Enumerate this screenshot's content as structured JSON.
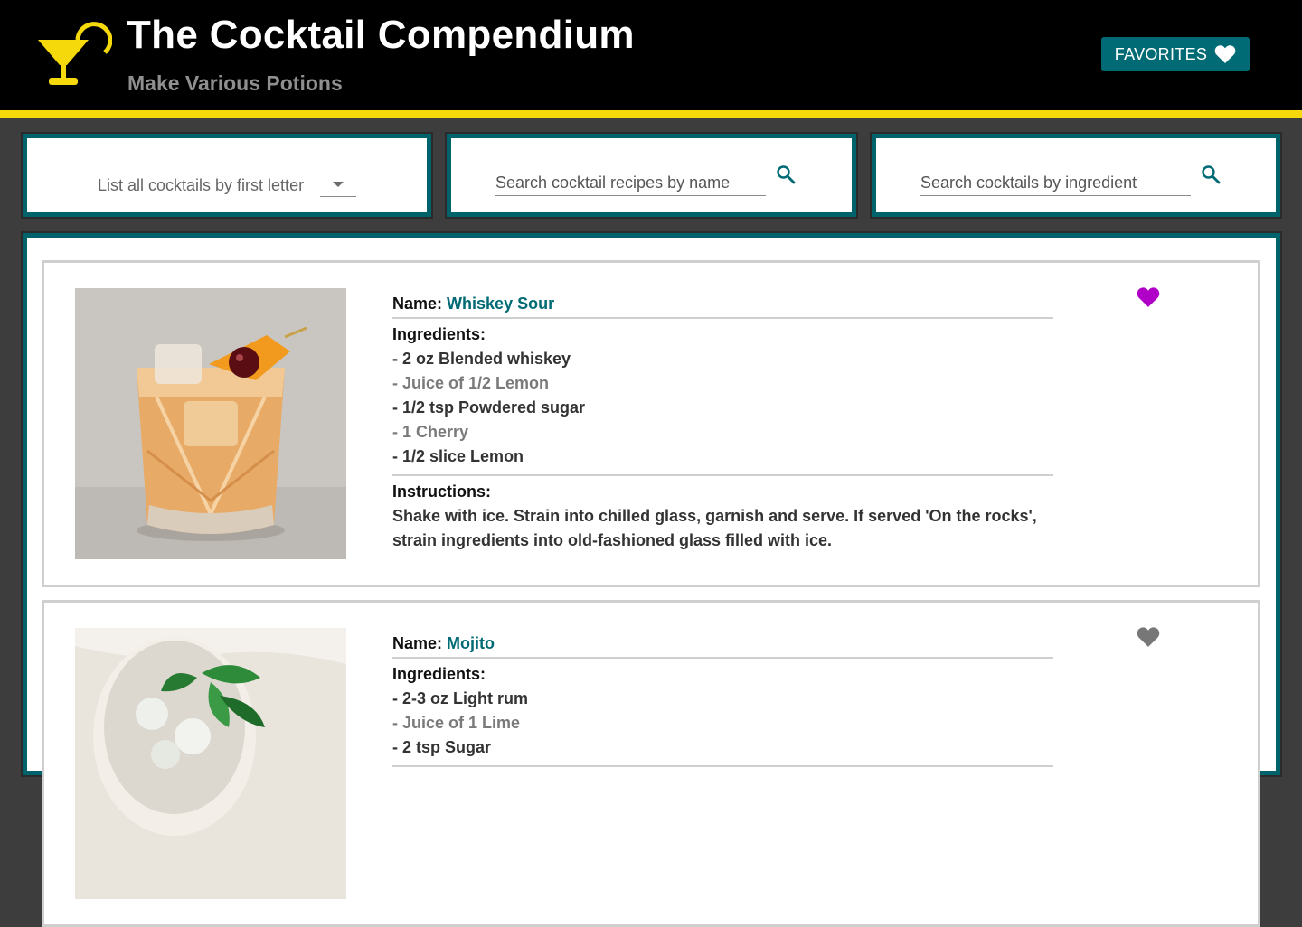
{
  "header": {
    "title": "The Cocktail Compendium",
    "subtitle": "Make Various Potions",
    "favorites_label": "FAVORITES",
    "accent_color": "#f5d90a",
    "logo_icon": "cocktail-glass-icon"
  },
  "search": {
    "letter_label": "List all cocktails by first letter",
    "name_placeholder": "Search cocktail recipes by name",
    "ingredient_placeholder": "Search cocktails by ingredient"
  },
  "labels": {
    "name": "Name:",
    "ingredients": "Ingredients:",
    "instructions": "Instructions:"
  },
  "cocktails": [
    {
      "name": "Whiskey Sour",
      "favorite": true,
      "ingredients": [
        "- 2 oz Blended whiskey",
        "- Juice of 1/2 Lemon",
        "- 1/2 tsp Powdered sugar",
        "- 1 Cherry",
        "- 1/2 slice Lemon"
      ],
      "instructions": "Shake with ice. Strain into chilled glass, garnish and serve. If served 'On the rocks', strain ingredients into old-fashioned glass filled with ice."
    },
    {
      "name": "Mojito",
      "favorite": false,
      "ingredients": [
        "- 2-3 oz Light rum",
        "- Juice of 1 Lime",
        "- 2 tsp Sugar"
      ],
      "instructions": ""
    }
  ],
  "colors": {
    "teal": "#006b74",
    "favorite_heart": "#b000c8",
    "inactive_heart": "#777777"
  }
}
